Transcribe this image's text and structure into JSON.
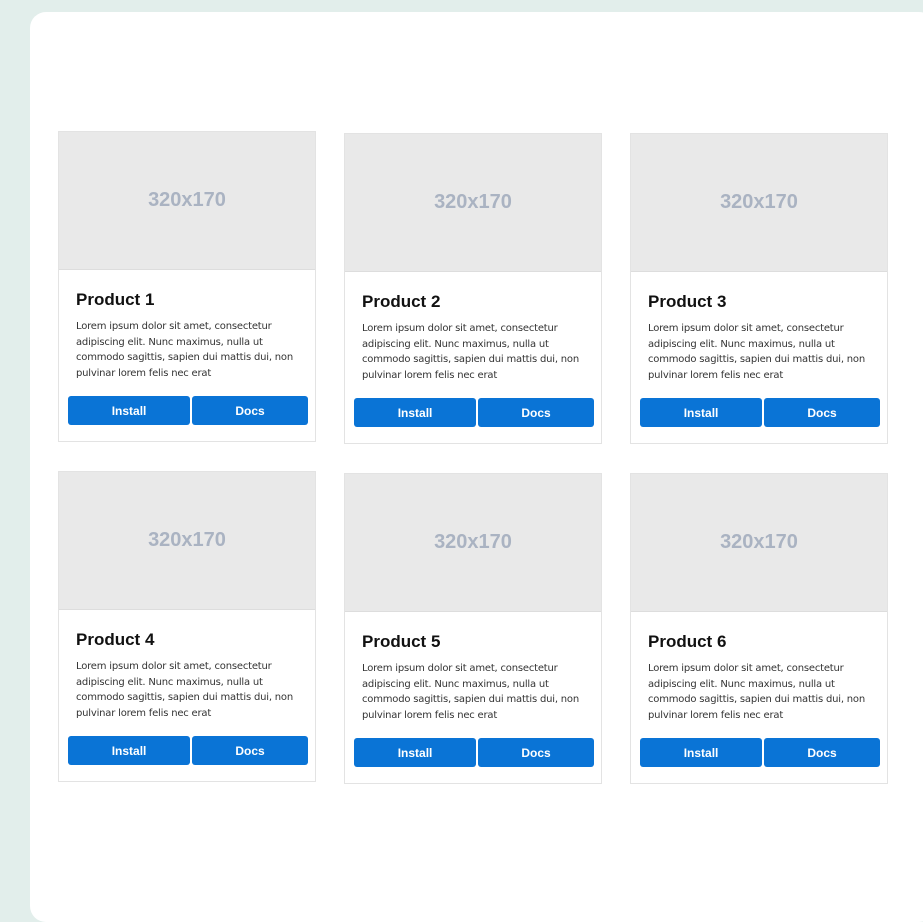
{
  "products": [
    {
      "image_label": "320x170",
      "title": "Product 1",
      "description": "Lorem ipsum dolor sit amet, consectetur adipiscing elit. Nunc maximus, nulla ut commodo sagittis, sapien dui mattis dui, non pulvinar lorem felis nec erat",
      "install_label": "Install",
      "docs_label": "Docs"
    },
    {
      "image_label": "320x170",
      "title": "Product 2",
      "description": "Lorem ipsum dolor sit amet, consectetur adipiscing elit. Nunc maximus, nulla ut commodo sagittis, sapien dui mattis dui, non pulvinar lorem felis nec erat",
      "install_label": "Install",
      "docs_label": "Docs"
    },
    {
      "image_label": "320x170",
      "title": "Product 3",
      "description": "Lorem ipsum dolor sit amet, consectetur adipiscing elit. Nunc maximus, nulla ut commodo sagittis, sapien dui mattis dui, non pulvinar lorem felis nec erat",
      "install_label": "Install",
      "docs_label": "Docs"
    },
    {
      "image_label": "320x170",
      "title": "Product 4",
      "description": "Lorem ipsum dolor sit amet, consectetur adipiscing elit. Nunc maximus, nulla ut commodo sagittis, sapien dui mattis dui, non pulvinar lorem felis nec erat",
      "install_label": "Install",
      "docs_label": "Docs"
    },
    {
      "image_label": "320x170",
      "title": "Product 5",
      "description": "Lorem ipsum dolor sit amet, consectetur adipiscing elit. Nunc maximus, nulla ut commodo sagittis, sapien dui mattis dui, non pulvinar lorem felis nec erat",
      "install_label": "Install",
      "docs_label": "Docs"
    },
    {
      "image_label": "320x170",
      "title": "Product 6",
      "description": "Lorem ipsum dolor sit amet, consectetur adipiscing elit. Nunc maximus, nulla ut commodo sagittis, sapien dui mattis dui, non pulvinar lorem felis nec erat",
      "install_label": "Install",
      "docs_label": "Docs"
    }
  ],
  "colors": {
    "page_background": "#e2eeeb",
    "panel_background": "#ffffff",
    "placeholder_background": "#e9e9e9",
    "placeholder_text": "#aab3c2",
    "button_background": "#0a74d6",
    "button_text": "#ffffff"
  }
}
